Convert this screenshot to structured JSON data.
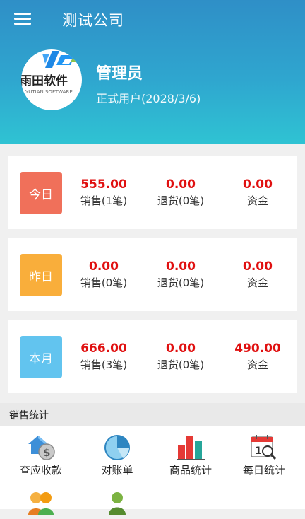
{
  "header": {
    "company_name": "测试公司",
    "user_name": "管理员",
    "user_status": "正式用户(2028/3/6)",
    "logo_text": "雨田软件",
    "logo_subtext": "YUTIAN SOFTWARE"
  },
  "cards": [
    {
      "period": "今日",
      "color": "#f0705a",
      "sales_value": "555.00",
      "sales_label": "销售(1笔)",
      "returns_value": "0.00",
      "returns_label": "退货(0笔)",
      "funds_value": "0.00",
      "funds_label": "资金"
    },
    {
      "period": "昨日",
      "color": "#f9ae3b",
      "sales_value": "0.00",
      "sales_label": "销售(0笔)",
      "returns_value": "0.00",
      "returns_label": "退货(0笔)",
      "funds_value": "0.00",
      "funds_label": "资金"
    },
    {
      "period": "本月",
      "color": "#62c4ef",
      "sales_value": "666.00",
      "sales_label": "销售(3笔)",
      "returns_value": "0.00",
      "returns_label": "退货(0笔)",
      "funds_value": "490.00",
      "funds_label": "资金"
    }
  ],
  "section_title": "销售统计",
  "grid": [
    {
      "label": "查应收款",
      "icon": "receivable-icon"
    },
    {
      "label": "对账单",
      "icon": "pie-chart-icon"
    },
    {
      "label": "商品统计",
      "icon": "bar-chart-icon"
    },
    {
      "label": "每日统计",
      "icon": "calendar-search-icon"
    },
    {
      "label": "",
      "icon": "customers-icon"
    },
    {
      "label": "",
      "icon": "person-icon"
    }
  ]
}
